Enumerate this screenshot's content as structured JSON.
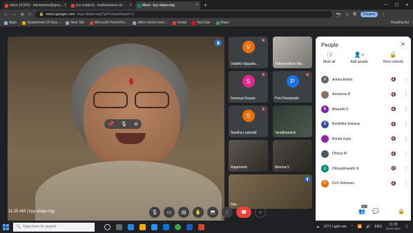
{
  "browser": {
    "tabs": [
      {
        "label": "Inbox (4,505) - mlesamms@gma...",
        "favicon_color": "#ea4335",
        "active": false
      },
      {
        "label": "(no subject) - muthumeena.mt...",
        "favicon_color": "#ea4335",
        "active": false
      },
      {
        "label": "Meet - kyy-ubqw-nqq",
        "favicon_color": "#00897b",
        "active": true
      }
    ],
    "new_tab": "+",
    "address": {
      "host": "meet.google.com",
      "path": "/kyy-ubqw-nqq?pli=1&authuser=1"
    },
    "paused_label": "Paused",
    "bookmarks": [
      {
        "label": "Apps",
        "color": "#8ab4f8"
      },
      {
        "label": "Department Of Scie...",
        "color": "#f9ab00"
      },
      {
        "label": "New Tab",
        "color": "#9aa0a6"
      },
      {
        "label": "Microsoft PowerPoi...",
        "color": "#d24726"
      },
      {
        "label": "office-memo-sent...",
        "color": "#9aa0a6"
      },
      {
        "label": "Gmail",
        "color": "#ea4335"
      },
      {
        "label": "YouTube",
        "color": "#ff0000"
      },
      {
        "label": "Maps",
        "color": "#34a853"
      }
    ],
    "reading_list": "Reading list"
  },
  "tiles": [
    {
      "name": "Vaideki Vijayaku...",
      "initial": "V",
      "color": "#e8710a",
      "kind": "avatar"
    },
    {
      "name": "Vidhyanathan Ma...",
      "initial": "",
      "color": "",
      "kind": "img"
    },
    {
      "name": "Saranya Reyalu",
      "initial": "S",
      "color": "#e52592",
      "kind": "avatar"
    },
    {
      "name": "Pavi Ramjanaki",
      "initial": "P",
      "color": "#1a73e8",
      "kind": "avatar"
    },
    {
      "name": "Swetha Loulestill",
      "initial": "S",
      "color": "#e8710a",
      "kind": "avatar"
    },
    {
      "name": "Tamilthendral",
      "initial": "",
      "color": "",
      "kind": "img2"
    },
    {
      "name": "Rajaneesh",
      "initial": "",
      "color": "",
      "kind": "img3"
    },
    {
      "name": "Meenia.V",
      "initial": "",
      "color": "",
      "kind": "img4"
    },
    {
      "name": "Nila",
      "initial": "",
      "color": "",
      "kind": "wide"
    }
  ],
  "people": {
    "title": "People",
    "actions": [
      {
        "label": "Mute all",
        "icon": "mic-off-icon"
      },
      {
        "label": "Add people",
        "icon": "person-add-icon"
      },
      {
        "label": "Host controls",
        "icon": "lock-icon"
      }
    ],
    "list": [
      {
        "name": "Anitha Anitha",
        "initial": "A",
        "color": "#5f6368"
      },
      {
        "name": "Anushree B",
        "initial": "",
        "color": "#8d6e63"
      },
      {
        "name": "Bharathi D",
        "initial": "B",
        "color": "#7b1fa2"
      },
      {
        "name": "Bowthika Selvaraj",
        "initial": "B",
        "color": "#3949ab"
      },
      {
        "name": "Brinda Kalai",
        "initial": "",
        "color": "#8e24aa"
      },
      {
        "name": "Dhivya M",
        "initial": "",
        "color": "#455a64"
      },
      {
        "name": "Dhivyabharathi N",
        "initial": "D",
        "color": "#00897b"
      },
      {
        "name": "Dr.K.Velumani",
        "initial": "D",
        "color": "#e8710a"
      }
    ]
  },
  "meeting": {
    "time": "11:25 AM",
    "separator": "|",
    "code": "kyy-ubqw-nqq",
    "participant_count": "37"
  },
  "taskbar": {
    "search_placeholder": "Type here to search",
    "weather": "12°C Light rain",
    "lang": "ENG",
    "clock_time": "11:25",
    "clock_date": "09-01-2022"
  }
}
